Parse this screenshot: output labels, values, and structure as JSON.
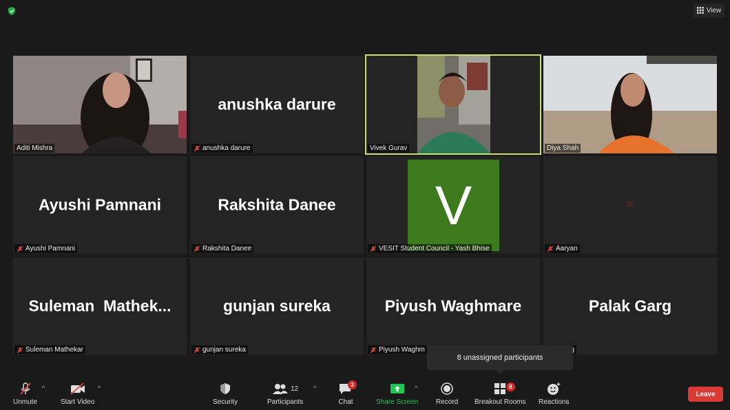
{
  "view": {
    "label": "View"
  },
  "tiles": [
    {
      "display": "",
      "label": "Aditi Mishra"
    },
    {
      "display": "anushka darure",
      "label": "anushka darure"
    },
    {
      "display": "",
      "label": "Vivek Gurav"
    },
    {
      "display": "",
      "label": "Diya Shah"
    },
    {
      "display": "Ayushi Pamnani",
      "label": "Ayushi Pamnani"
    },
    {
      "display": "Rakshita Danee",
      "label": "Rakshita Danee"
    },
    {
      "display": "V",
      "label": "VESIT Student Council - Yash Bhise"
    },
    {
      "display": "",
      "label": "Aaryan"
    },
    {
      "display": "Suleman  Mathek...",
      "label": "Suleman Mathekar"
    },
    {
      "display": "gunjan sureka",
      "label": "gunjan sureka"
    },
    {
      "display": "Piyush Waghmare",
      "label": "Piyush Waghm"
    },
    {
      "display": "Palak Garg",
      "label": "rg"
    }
  ],
  "tooltip": {
    "text": "8 unassigned participants"
  },
  "toolbar": {
    "unmute": "Unmute",
    "start_video": "Start Video",
    "security": "Security",
    "participants": "Participants",
    "participants_count": "12",
    "chat": "Chat",
    "chat_badge": "3",
    "share_screen": "Share Screen",
    "record": "Record",
    "breakout_rooms": "Breakout Rooms",
    "breakout_badge": "8",
    "reactions": "Reactions",
    "leave": "Leave"
  },
  "colors": {
    "active_border": "#c9e16b",
    "share_green": "#23c552",
    "leave_red": "#d93b36",
    "avatar_green": "#3d7a1e"
  }
}
